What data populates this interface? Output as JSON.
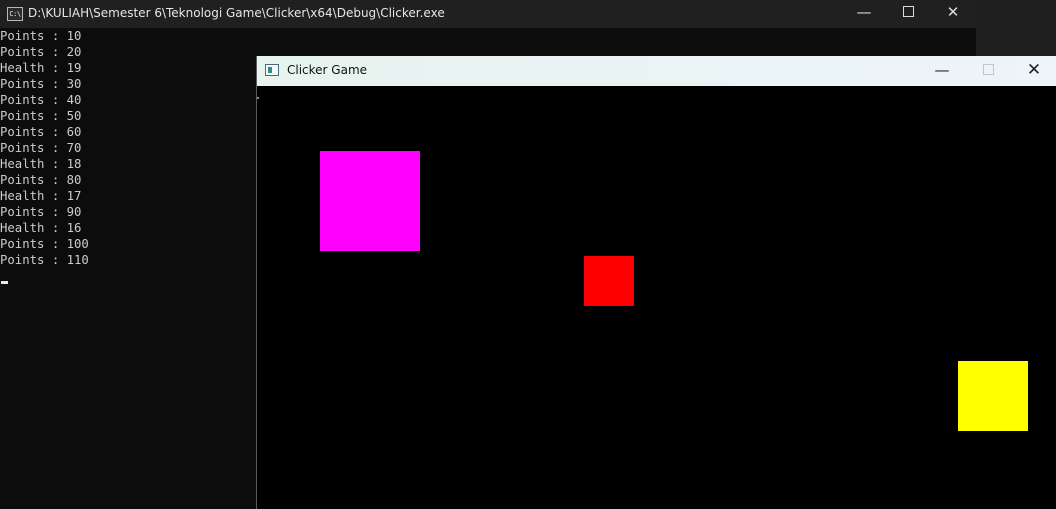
{
  "console": {
    "title": "D:\\KULIAH\\Semester 6\\Teknologi Game\\Clicker\\x64\\Debug\\Clicker.exe",
    "icon_text": "C:\\",
    "icon": "console-app-icon",
    "minimize_glyph": "—",
    "close_glyph": "✕",
    "lines": [
      "Points : 10",
      "Points : 20",
      "Health : 19",
      "Points : 30",
      "Points : 40",
      "Points : 50",
      "Points : 60",
      "Points : 70",
      "Health : 18",
      "Points : 80",
      "Health : 17",
      "Points : 90",
      "Health : 16",
      "Points : 100",
      "Points : 110"
    ]
  },
  "game": {
    "title": "Clicker Game",
    "icon": "game-window-icon",
    "minimize_glyph": "—",
    "close_glyph": "✕",
    "targets": [
      {
        "name": "magenta-square",
        "color": "#ff00ff"
      },
      {
        "name": "red-square",
        "color": "#ff0000"
      },
      {
        "name": "yellow-square",
        "color": "#ffff00"
      }
    ]
  },
  "colors": {
    "console_bg": "#0c0c0c",
    "console_text": "#cccccc",
    "titlebar_dark": "#202020",
    "game_canvas_bg": "#000000"
  },
  "background_strip": {
    "icons": [
      "bookmark-star-icon",
      "bookmark-star-icon",
      "bookmark-star-icon",
      "chevron-down-icon"
    ]
  }
}
